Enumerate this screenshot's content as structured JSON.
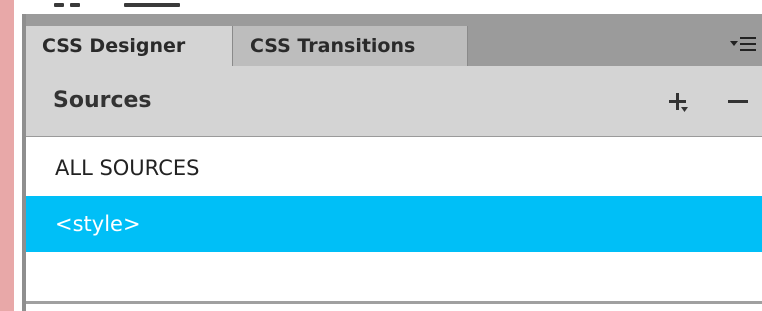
{
  "tabs": {
    "active_label": "CSS Designer",
    "inactive_label": "CSS Transitions"
  },
  "sources": {
    "title": "Sources",
    "items": [
      {
        "label": "ALL SOURCES",
        "selected": false
      },
      {
        "label": "<style>",
        "selected": true
      }
    ]
  },
  "icons": {
    "panel_menu": "panel-options-menu-icon",
    "add": "plus-icon",
    "remove": "minus-icon"
  },
  "colors": {
    "selection": "#00bff7",
    "header_bg": "#d4d4d4",
    "tabbar_bg": "#9b9b9b"
  }
}
